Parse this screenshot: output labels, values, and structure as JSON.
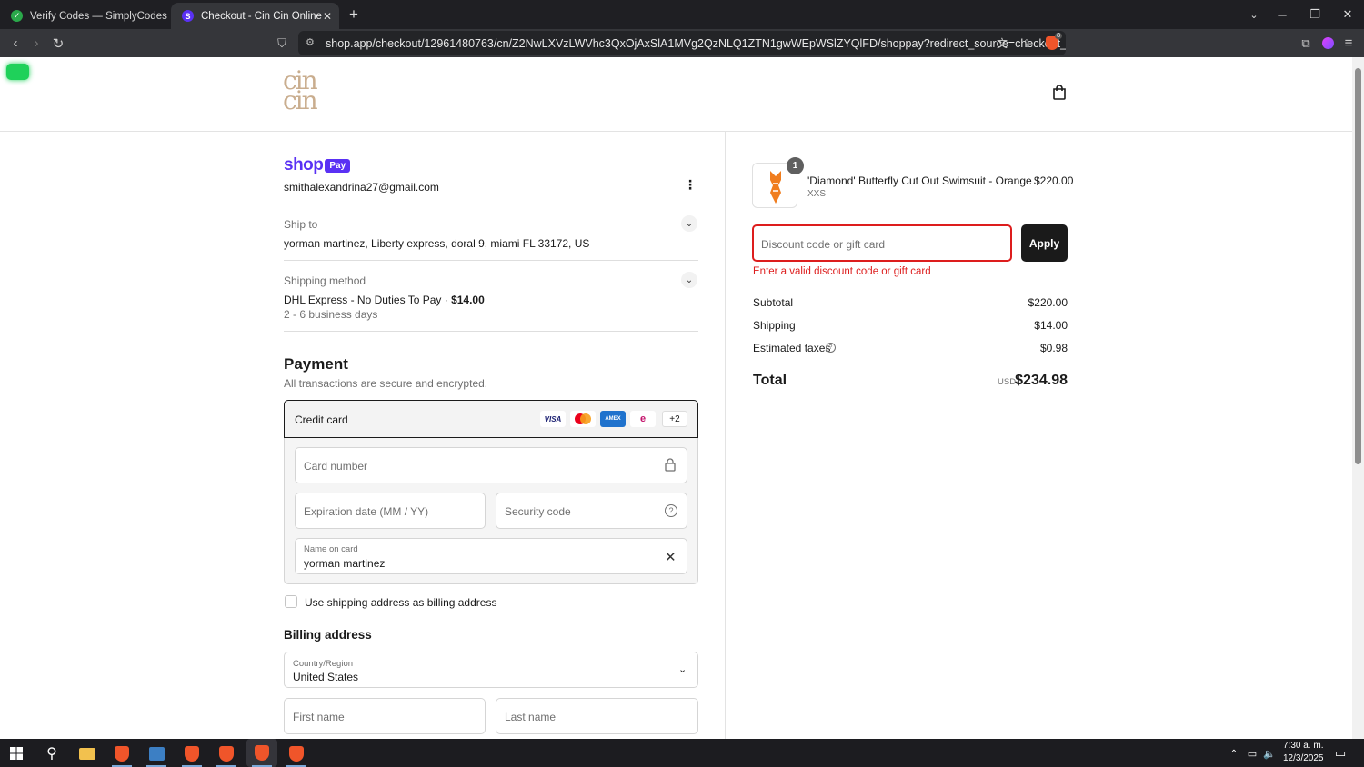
{
  "browser": {
    "tabs": [
      {
        "title": "Verify Codes — SimplyCodes",
        "active": false
      },
      {
        "title": "Checkout - Cin Cin Online",
        "active": true
      }
    ],
    "url": "shop.app/checkout/12961480763/cn/Z2NwLXVzLWVhc3QxOjAxSlA1MVg2QzNLQ1ZTN1gwWEpWSlZYQlFD/shoppay?redirect_source=checkout_univ...",
    "shield_badge": "8"
  },
  "store": {
    "logo_line1": "cin",
    "logo_line2": "cin"
  },
  "shop_pay": {
    "word": "shop",
    "badge": "Pay",
    "email": "smithalexandrina27@gmail.com"
  },
  "ship_to": {
    "label": "Ship to",
    "value": "yorman martinez, Liberty express, doral 9, miami FL 33172, US"
  },
  "shipping_method": {
    "label": "Shipping method",
    "name": "DHL Express - No Duties To Pay · ",
    "price": "$14.00",
    "eta": "2 - 6 business days"
  },
  "payment": {
    "title": "Payment",
    "subtitle": "All transactions are secure and encrypted.",
    "method_label": "Credit card",
    "card_logos": [
      "VISA",
      "MC",
      "AMEX",
      "elo",
      "+2"
    ],
    "card_number_placeholder": "Card number",
    "expiry_placeholder": "Expiration date (MM / YY)",
    "security_placeholder": "Security code",
    "name_label": "Name on card",
    "name_value": "yorman martinez",
    "billing_checkbox_label": "Use shipping address as billing address",
    "billing_checked": false
  },
  "billing": {
    "title": "Billing address",
    "country_label": "Country/Region",
    "country_value": "United States",
    "first_name_placeholder": "First name",
    "last_name_placeholder": "Last name"
  },
  "summary": {
    "item": {
      "qty": "1",
      "name": "'Diamond' Butterfly Cut Out Swimsuit - Orange",
      "variant": "XXS",
      "price": "$220.00"
    },
    "discount_placeholder": "Discount code or gift card",
    "apply_label": "Apply",
    "discount_error": "Enter a valid discount code or gift card",
    "subtotal_label": "Subtotal",
    "subtotal": "$220.00",
    "shipping_label": "Shipping",
    "shipping": "$14.00",
    "taxes_label": "Estimated taxes",
    "taxes": "$0.98",
    "total_label": "Total",
    "currency": "USD",
    "total": "$234.98"
  },
  "taskbar": {
    "time": "7:30 a. m.",
    "date": "12/3/2025"
  },
  "colors": {
    "shop_purple": "#5a31f4",
    "error_red": "#dd1d1d",
    "apply_bg": "#1a1a1a",
    "item_orange": "#f07d1e"
  }
}
